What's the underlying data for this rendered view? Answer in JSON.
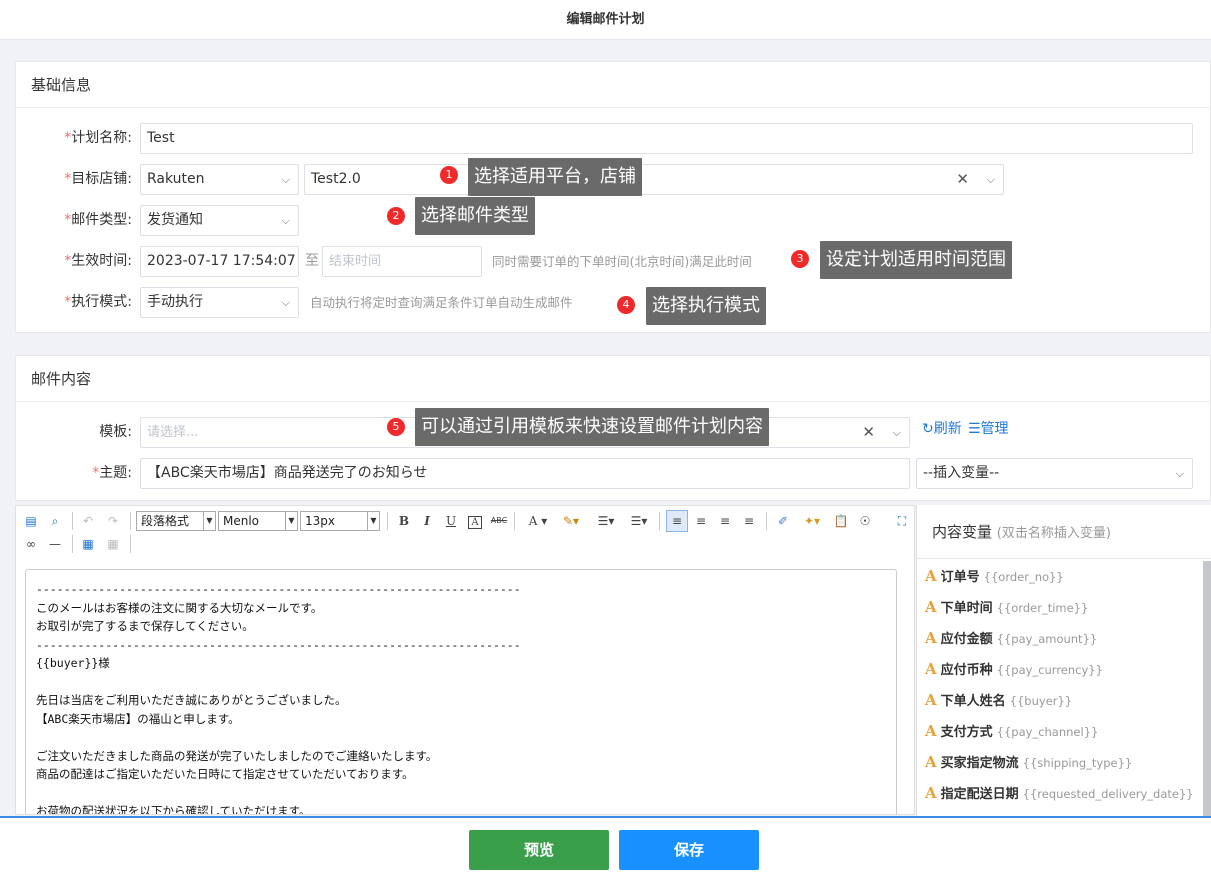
{
  "page": {
    "title": "编辑邮件计划"
  },
  "basic": {
    "title": "基础信息",
    "plan_name_label": "计划名称:",
    "plan_name_value": "Test",
    "target_store_label": "目标店铺:",
    "platform_value": "Rakuten",
    "store_value": "Test2.0",
    "mail_type_label": "邮件类型:",
    "mail_type_value": "发货通知",
    "effective_time_label": "生效时间:",
    "start_time_value": "2023-07-17 17:54:07",
    "to_text": "至",
    "end_time_placeholder": "结束时间",
    "time_hint": "同时需要订单的下单时间(北京时间)满足此时间",
    "exec_mode_label": "执行模式:",
    "exec_mode_value": "手动执行",
    "exec_hint": "自动执行将定时查询满足条件订单自动生成邮件",
    "required_mark": "*"
  },
  "callouts": [
    {
      "num": "1",
      "text": "选择适用平台，店铺"
    },
    {
      "num": "2",
      "text": "选择邮件类型"
    },
    {
      "num": "3",
      "text": "设定计划适用时间范围"
    },
    {
      "num": "4",
      "text": "选择执行模式"
    },
    {
      "num": "5",
      "text": "可以通过引用模板来快速设置邮件计划内容"
    }
  ],
  "content": {
    "title": "邮件内容",
    "template_label": "模板:",
    "template_placeholder": "请选择...",
    "refresh_link": "刷新",
    "manage_link": "管理",
    "subject_label": "主题:",
    "subject_value": "【ABC楽天市場店】商品発送完了のお知らせ",
    "insert_var_value": "--插入变量--"
  },
  "toolbar": {
    "paragraph_format": "段落格式",
    "font_family": "Menlo",
    "font_size": "13px",
    "bold": "B",
    "italic": "I",
    "underline": "U",
    "strike": "ABC",
    "font_color": "A"
  },
  "editor": {
    "body": "----------------------------------------------------------------------\nこのメールはお客様の注文に関する大切なメールです。\nお取引が完了するまで保存してください。\n----------------------------------------------------------------------\n{{buyer}}様\n\n先日は当店をご利用いただき誠にありがとうございました。\n【ABC楽天市場店】の福山と申します。\n\nご注文いただきました商品の発送が完了いたしましたのでご連絡いたします。\n商品の配達はご指定いただいた日時にて指定させていただいております。\n\nお荷物の配送状況を以下から確認していただけます。\n※伝票番号反映まで時間がかかる場合がございます。"
  },
  "variables": {
    "title": "内容变量",
    "subtitle": "(双击名称插入变量)",
    "icon_letter": "A",
    "items": [
      {
        "name": "订单号",
        "code": "{{order_no}}"
      },
      {
        "name": "下单时间",
        "code": "{{order_time}}"
      },
      {
        "name": "应付金额",
        "code": "{{pay_amount}}"
      },
      {
        "name": "应付币种",
        "code": "{{pay_currency}}"
      },
      {
        "name": "下单人姓名",
        "code": "{{buyer}}"
      },
      {
        "name": "支付方式",
        "code": "{{pay_channel}}"
      },
      {
        "name": "买家指定物流",
        "code": "{{shipping_type}}"
      },
      {
        "name": "指定配送日期",
        "code": "{{requested_delivery_date}}"
      }
    ]
  },
  "footer": {
    "preview_label": "预览",
    "save_label": "保存",
    "preview_color": "#3a9f4a",
    "save_color": "#1890ff"
  }
}
